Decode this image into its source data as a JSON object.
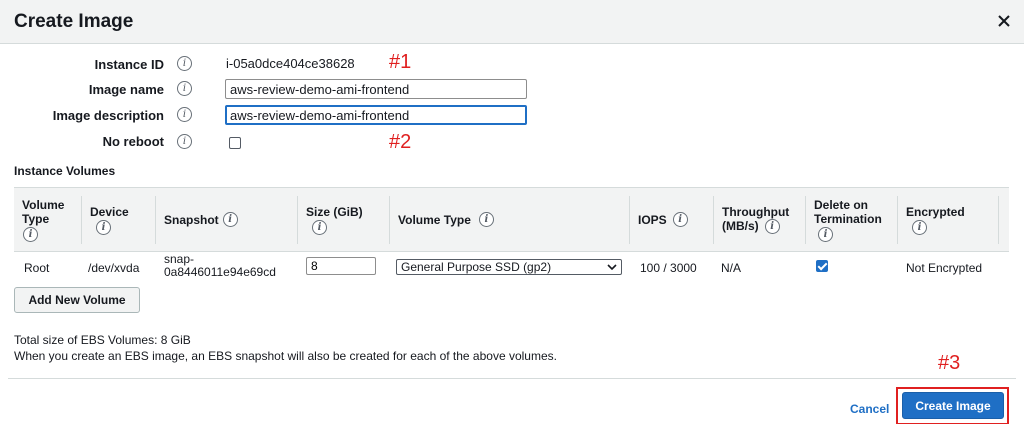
{
  "dialog": {
    "title": "Create Image"
  },
  "form": {
    "instance_id_label": "Instance ID",
    "instance_id_value": "i-05a0dce404ce38628",
    "image_name_label": "Image name",
    "image_name_value": "aws-review-demo-ami-frontend",
    "image_description_label": "Image description",
    "image_description_value": "aws-review-demo-ami-frontend",
    "no_reboot_label": "No reboot",
    "no_reboot_checked": false
  },
  "annotations": {
    "a1": "#1",
    "a2": "#2",
    "a3": "#3"
  },
  "volumes": {
    "section_title": "Instance Volumes",
    "headers": {
      "volume_type_1": "Volume",
      "volume_type_2": "Type",
      "device": "Device",
      "snapshot": "Snapshot",
      "size": "Size (GiB)",
      "vol_type": "Volume Type",
      "iops": "IOPS",
      "throughput_1": "Throughput",
      "throughput_2": "(MB/s)",
      "delete_1": "Delete on",
      "delete_2": "Termination",
      "encrypted": "Encrypted"
    },
    "rows": [
      {
        "volume_type": "Root",
        "device": "/dev/xvda",
        "snapshot_1": "snap-",
        "snapshot_2": "0a8446011e94e69cd",
        "size": "8",
        "vol_type": "General Purpose SSD (gp2)",
        "iops": "100 / 3000",
        "throughput": "N/A",
        "delete_on_termination": true,
        "encrypted": "Not Encrypted"
      }
    ],
    "add_button": "Add New Volume"
  },
  "summary": {
    "total_size": "Total size of EBS Volumes: 8 GiB",
    "note": "When you create an EBS image, an EBS snapshot will also be created for each of the above volumes."
  },
  "footer": {
    "cancel": "Cancel",
    "create": "Create Image"
  },
  "icons": {
    "info_glyph": "i",
    "select_chevron": "⌄"
  },
  "colors": {
    "primary": "#1f6fc5",
    "annotation": "#e02020",
    "header_bg": "#f2f3f3"
  }
}
